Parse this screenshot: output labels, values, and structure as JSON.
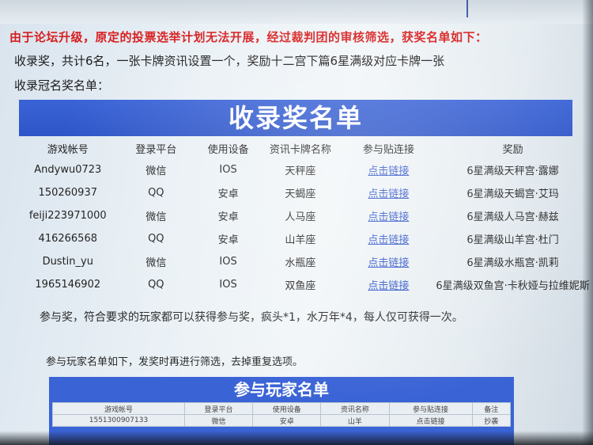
{
  "header": {
    "headline": "由于论坛升级，原定的投票选举计划无法开展，经过裁判团的审核筛选，获奖名单如下：",
    "line2": "收录奖，共计6名，一张卡牌资讯设置一个，奖励十二宫下篇6星满级对应卡牌一张",
    "line3": "收录冠名奖名单："
  },
  "award_table": {
    "title": "收录奖名单",
    "headers": [
      "游戏帐号",
      "登录平台",
      "使用设备",
      "资讯卡牌名称",
      "参与贴连接",
      "奖励"
    ],
    "rows": [
      [
        "Andywu0723",
        "微信",
        "IOS",
        "天秤座",
        "点击链接",
        "6星满级天秤宫·露娜"
      ],
      [
        "150260937",
        "QQ",
        "安卓",
        "天蝎座",
        "点击链接",
        "6星满级天蝎宫·艾玛"
      ],
      [
        "feiji223971000",
        "微信",
        "安卓",
        "人马座",
        "点击链接",
        "6星满级人马宫·赫兹"
      ],
      [
        "416266568",
        "QQ",
        "安卓",
        "山羊座",
        "点击链接",
        "6星满级山羊宫·杜门"
      ],
      [
        "Dustin_yu",
        "微信",
        "IOS",
        "水瓶座",
        "点击链接",
        "6星满级水瓶宫·凯莉"
      ],
      [
        "1965146902",
        "QQ",
        "IOS",
        "双鱼座",
        "点击链接",
        "6星满级双鱼宫·卡秋娅与拉维妮斯"
      ]
    ]
  },
  "notes": {
    "participation": "参与奖，符合要求的玩家都可以获得参与奖，疯头*1，水万年*4，每人仅可获得一次。",
    "player_list_intro": "参与玩家名单如下，发奖时再进行筛选，去掉重复选项。"
  },
  "player_table": {
    "title": "参与玩家名单",
    "headers": [
      "游戏帐号",
      "登录平台",
      "使用设备",
      "资讯名称",
      "参与贴连接",
      "备注"
    ],
    "rows": [
      [
        "1551300907133",
        "微信",
        "安卓",
        "山羊",
        "点击链接",
        "抄袭"
      ]
    ]
  }
}
